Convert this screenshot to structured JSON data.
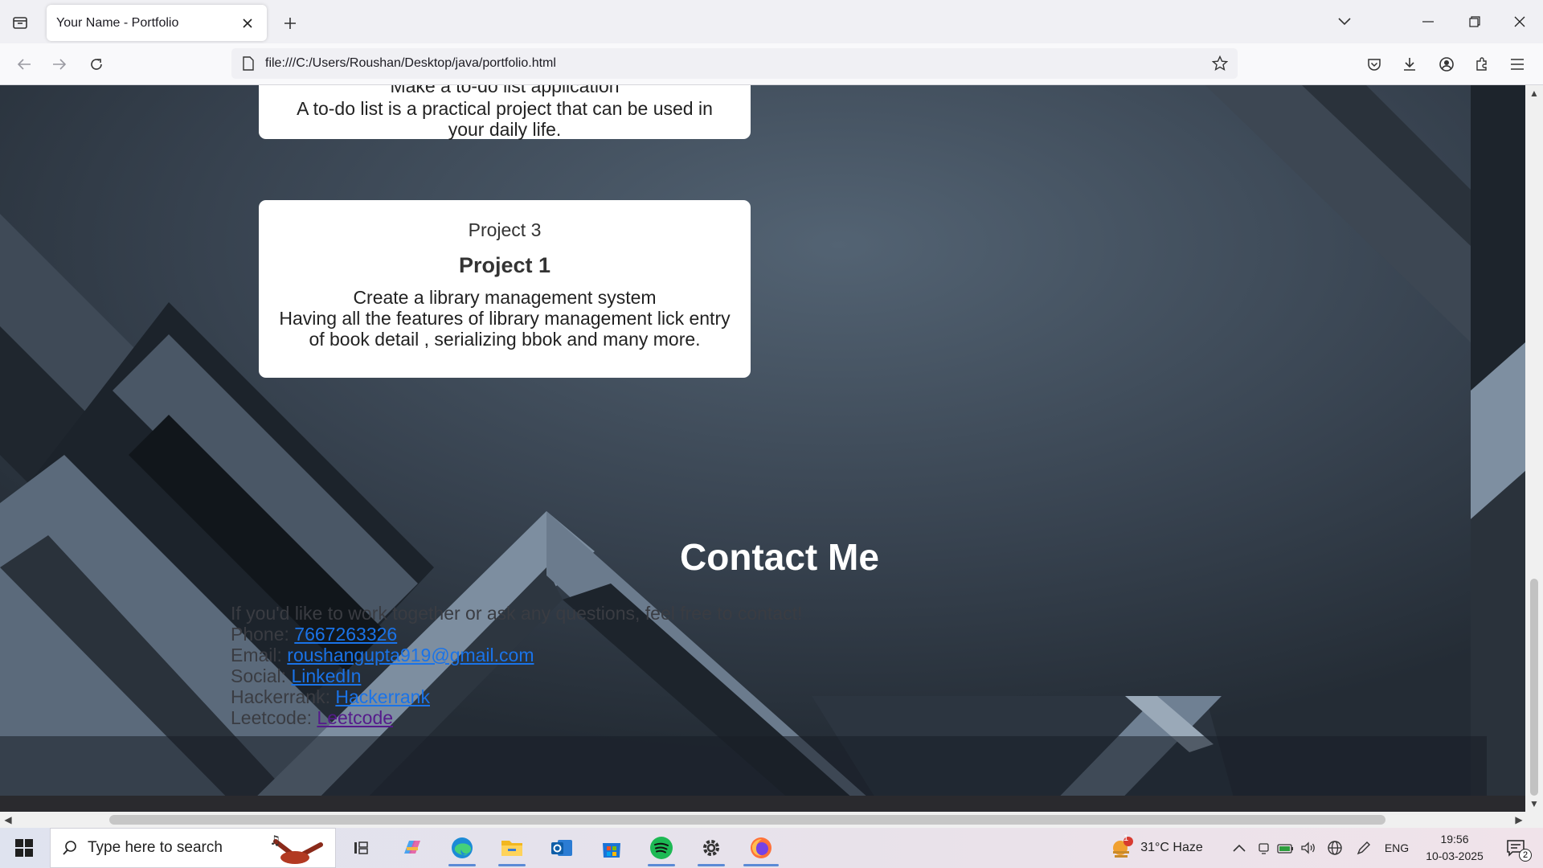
{
  "browser": {
    "tab_title": "Your Name - Portfolio",
    "url": "file:///C:/Users/Roushan/Desktop/java/portfolio.html"
  },
  "page": {
    "card_top": {
      "cutoff_line": "Make a to-do list application",
      "description": "A to-do list is a practical project that can be used in your daily life."
    },
    "card_project3": {
      "label": "Project 3",
      "heading": "Project 1",
      "line1": "Create a library management system",
      "description": "Having all the features of library management lick entry of book detail , serializing bbok and many more."
    },
    "contact": {
      "title": "Contact Me",
      "intro": "If you'd like to work together or ask any questions, feel free to contact!",
      "phone_label": "Phone:",
      "phone": "7667263326",
      "email_label": "Email:",
      "email": "roushangupta919@gmail.com",
      "social_label": "Social:",
      "social_link": "LinkedIn",
      "hackerrank_label": "Hackerrank:",
      "hackerrank_link": "Hackerrank",
      "leetcode_label": "Leetcode:",
      "leetcode_link": "Leetcode"
    }
  },
  "taskbar": {
    "search_placeholder": "Type here to search",
    "weather": "31°C  Haze",
    "weather_badge": "1",
    "language": "ENG",
    "time": "19:56",
    "date": "10-03-2025",
    "notifications": "2"
  },
  "colors": {
    "link": "#1a73e8",
    "visited_link": "#551a8b",
    "page_bg": "#2b3540"
  }
}
